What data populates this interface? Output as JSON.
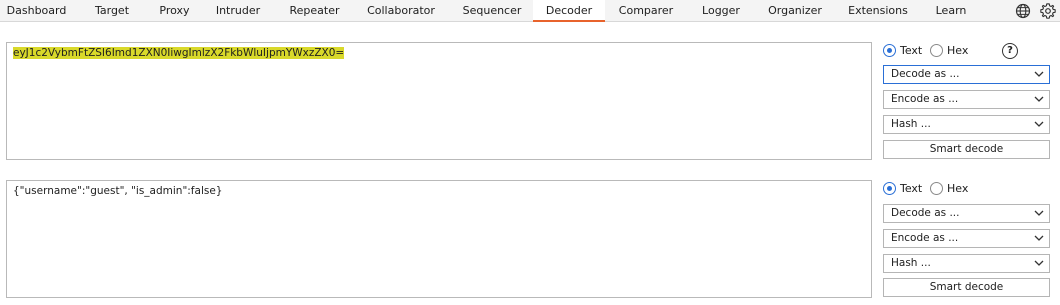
{
  "tabs": [
    {
      "label": "Dashboard"
    },
    {
      "label": "Target"
    },
    {
      "label": "Proxy"
    },
    {
      "label": "Intruder"
    },
    {
      "label": "Repeater"
    },
    {
      "label": "Collaborator"
    },
    {
      "label": "Sequencer"
    },
    {
      "label": "Decoder",
      "active": true
    },
    {
      "label": "Comparer"
    },
    {
      "label": "Logger"
    },
    {
      "label": "Organizer"
    },
    {
      "label": "Extensions"
    },
    {
      "label": "Learn"
    }
  ],
  "toolbar_icons": [
    "globe-icon",
    "gear-icon"
  ],
  "accent_color": "#e8632c",
  "highlight_color": "#d9d92a",
  "panels": [
    {
      "content": "eyJ1c2VybmFtZSI6Imd1ZXN0IiwgImlzX2FkbWluIjpmYWxzZX0=",
      "content_highlighted": true,
      "mode_text_label": "Text",
      "mode_hex_label": "Hex",
      "selected_mode": "Text",
      "help_label": "?",
      "decode_label": "Decode as ...",
      "encode_label": "Encode as ...",
      "hash_label": "Hash ...",
      "smart_decode_label": "Smart decode"
    },
    {
      "content": "{\"username\":\"guest\", \"is_admin\":false}",
      "content_highlighted": false,
      "mode_text_label": "Text",
      "mode_hex_label": "Hex",
      "selected_mode": "Text",
      "decode_label": "Decode as ...",
      "encode_label": "Encode as ...",
      "hash_label": "Hash ...",
      "smart_decode_label": "Smart decode"
    }
  ]
}
